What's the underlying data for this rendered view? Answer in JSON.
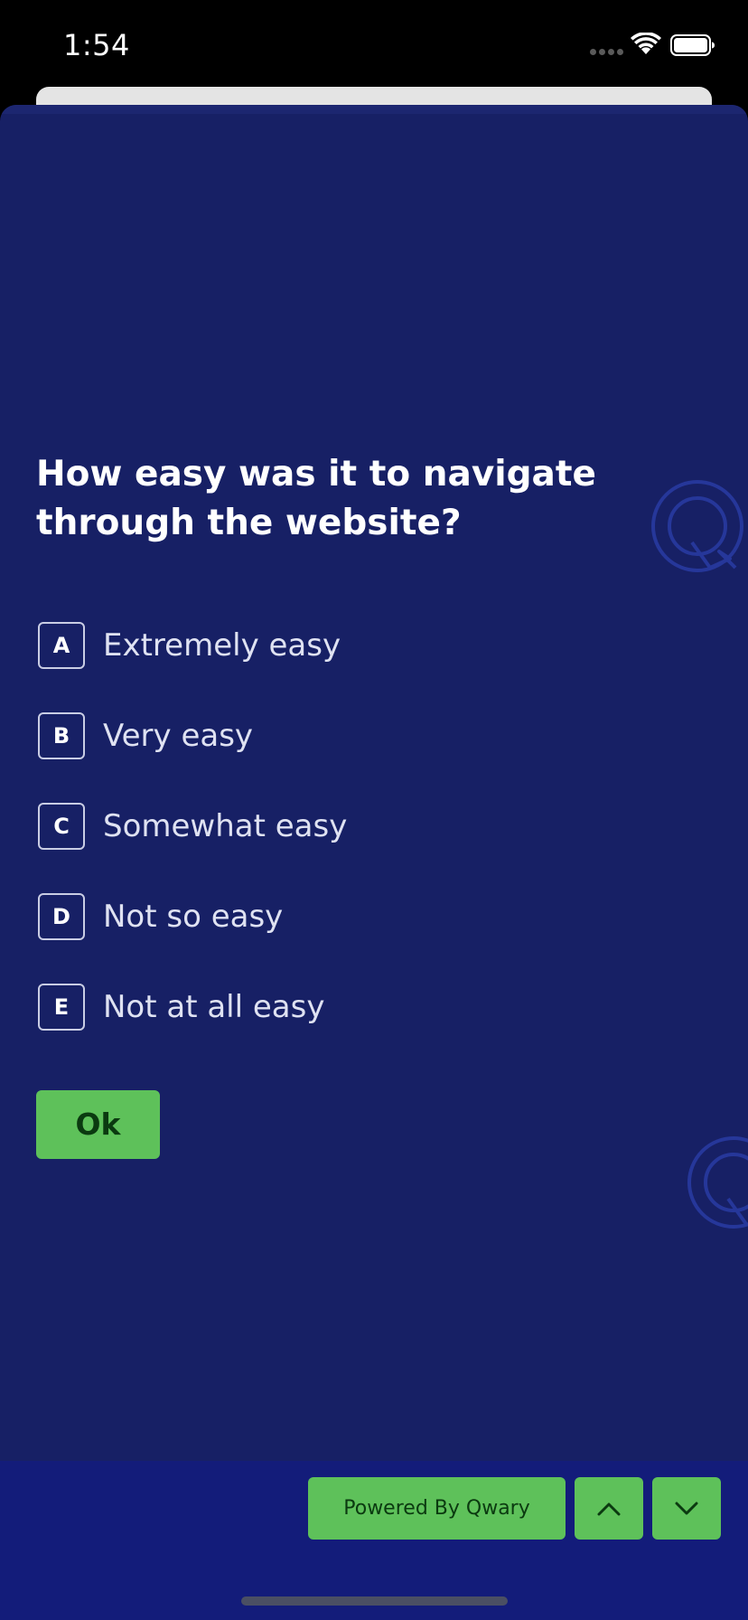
{
  "status_bar": {
    "time": "1:54"
  },
  "survey": {
    "question": "How easy was it to navigate through the website?",
    "options": [
      {
        "key": "A",
        "label": "Extremely easy"
      },
      {
        "key": "B",
        "label": "Very easy"
      },
      {
        "key": "C",
        "label": "Somewhat easy"
      },
      {
        "key": "D",
        "label": "Not so easy"
      },
      {
        "key": "E",
        "label": "Not at all easy"
      }
    ],
    "submit_label": "Ok"
  },
  "footer": {
    "powered_by": "Powered By Qwary",
    "up_icon": "chevron-up-icon",
    "down_icon": "chevron-down-icon"
  },
  "colors": {
    "background": "#172065",
    "footer": "#131c7a",
    "accent": "#5ec15a",
    "watermark": "#26379a"
  }
}
